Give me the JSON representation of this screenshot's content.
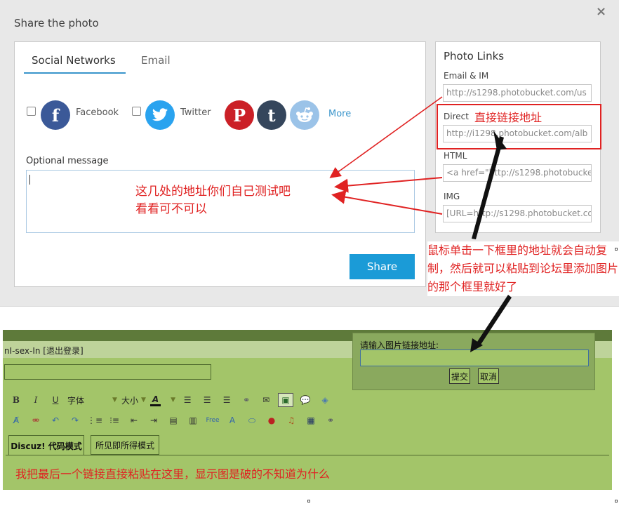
{
  "modal": {
    "title": "Share the photo",
    "close_glyph": "×",
    "tabs": [
      {
        "label": "Social Networks",
        "active": true
      },
      {
        "label": "Email",
        "active": false
      }
    ],
    "networks": [
      {
        "name": "Facebook",
        "label": "Facebook",
        "icon": "facebook-icon",
        "glyph": "f",
        "color": "#3b5998"
      },
      {
        "name": "Twitter",
        "label": "Twitter",
        "icon": "twitter-icon",
        "glyph": "🐦",
        "color": "#2aa3ef"
      },
      {
        "name": "Pinterest",
        "icon": "pinterest-icon",
        "glyph": "P",
        "color": "#cb2027"
      },
      {
        "name": "Tumblr",
        "icon": "tumblr-icon",
        "glyph": "t",
        "color": "#35465c"
      },
      {
        "name": "Reddit",
        "icon": "reddit-icon",
        "glyph": "◕",
        "color": "#9bc3e8"
      }
    ],
    "more_label": "More",
    "message_label": "Optional message",
    "message_value": "",
    "share_label": "Share",
    "photo_links": {
      "title": "Photo Links",
      "fields": [
        {
          "label": "Email & IM",
          "value": "http://s1298.photobucket.com/us"
        },
        {
          "label": "Direct",
          "value": "http://i1298.photobucket.com/alb"
        },
        {
          "label": "HTML",
          "value": "<a href=\"http://s1298.photobucke"
        },
        {
          "label": "IMG",
          "value": "[URL=http://s1298.photobucket.co"
        }
      ]
    }
  },
  "annotations": {
    "direct": "直接链接地址",
    "message": "这几处的地址你们自己测试吧\n看看可不可以",
    "right": "鼠标单击一下框里的地址就会自动复制，然后就可以粘贴到论坛里添加图片的那个框里就好了",
    "bottom": "我把最后一个链接直接粘贴在这里，显示图是破的不知道为什么",
    "color": "#e02222"
  },
  "forum": {
    "user_text": "nI-sex-In [退出登录]",
    "toolbar_row1": {
      "bold": "B",
      "italic": "I",
      "underline": "U",
      "font_label": "字体",
      "size_label": "大小",
      "color_label": "A"
    },
    "modes": [
      "Discuz! 代码模式",
      "所见即所得模式"
    ],
    "url_dialog": {
      "label": "请输入图片链接地址:",
      "value": "",
      "submit": "提交",
      "cancel": "取消"
    }
  }
}
